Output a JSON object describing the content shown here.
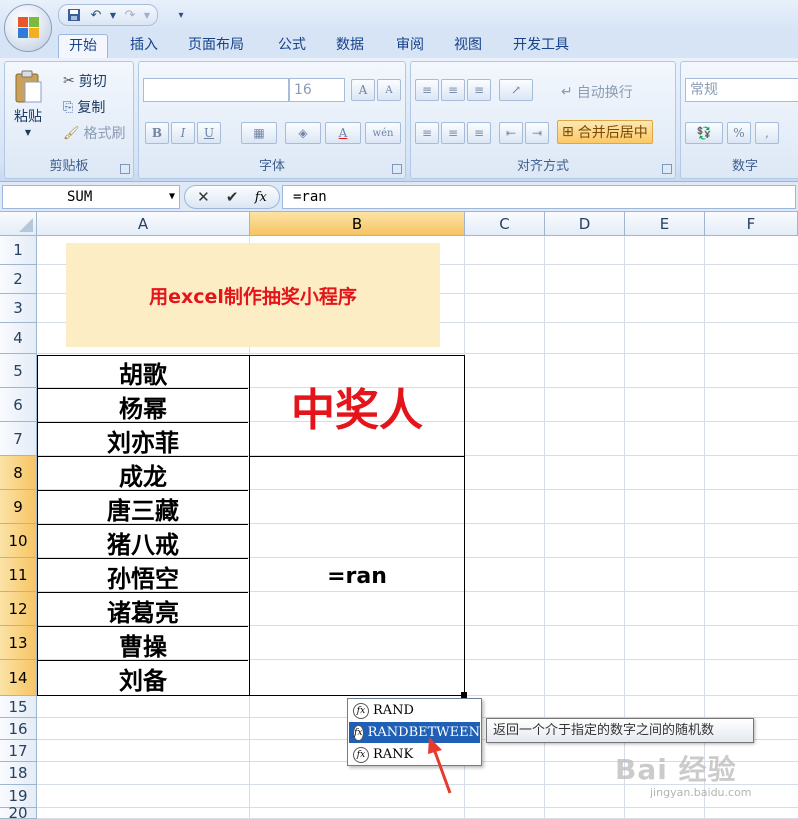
{
  "quick_access": {
    "save_icon": "save-icon",
    "undo_icon": "undo-icon",
    "redo_icon": "redo-icon",
    "customize_icon": "customize-qat-icon"
  },
  "tabs": [
    {
      "label": "开始",
      "active": true
    },
    {
      "label": "插入"
    },
    {
      "label": "页面布局"
    },
    {
      "label": "公式"
    },
    {
      "label": "数据"
    },
    {
      "label": "审阅"
    },
    {
      "label": "视图"
    },
    {
      "label": "开发工具"
    }
  ],
  "ribbon": {
    "clipboard": {
      "paste": "粘贴",
      "cut": "剪切",
      "copy": "复制",
      "format_painter": "格式刷",
      "label": "剪贴板"
    },
    "font": {
      "font_name": "",
      "font_size": "16",
      "label": "字体",
      "bold": "B",
      "italic": "I",
      "underline": "U",
      "grow": "A",
      "shrink": "A",
      "wen": "wén"
    },
    "alignment": {
      "wrap": "自动换行",
      "merge": "合并后居中",
      "label": "对齐方式"
    },
    "number": {
      "format": "常规",
      "percent": "%",
      "comma": ",",
      "label": "数字"
    }
  },
  "formula_bar": {
    "name_box": "SUM",
    "cancel": "✕",
    "enter": "✔",
    "fx": "fx",
    "formula": "=ran"
  },
  "columns": [
    "A",
    "B",
    "C",
    "D",
    "E",
    "F"
  ],
  "rows": [
    "1",
    "2",
    "3",
    "4",
    "5",
    "6",
    "7",
    "8",
    "9",
    "10",
    "11",
    "12",
    "13",
    "14",
    "15",
    "16",
    "17",
    "18",
    "19",
    "20"
  ],
  "sheet": {
    "banner": "用excel制作抽奖小程序",
    "names": [
      "胡歌",
      "杨幂",
      "刘亦菲",
      "成龙",
      "唐三藏",
      "猪八戒",
      "孙悟空",
      "诸葛亮",
      "曹操",
      "刘备"
    ],
    "winner_label": "中奖人",
    "formula_cell": "=ran"
  },
  "autocomplete": {
    "items": [
      "RAND",
      "RANDBETWEEN",
      "RANK"
    ],
    "selected_index": 1,
    "tooltip": "返回一个介于指定的数字之间的随机数"
  },
  "watermark": {
    "text": "Bai 经验",
    "sub": "jingyan.baidu.com"
  },
  "colors": {
    "accent_red": "#e4141b",
    "banner_bg": "#fdedc5",
    "selection_blue": "#1f5fb6",
    "header_highlight": "#f7c463"
  }
}
